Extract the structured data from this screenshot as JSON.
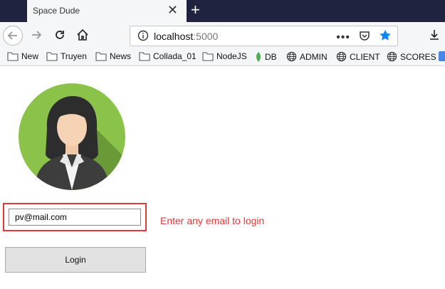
{
  "browser": {
    "tab": {
      "title": "Space Dude",
      "close_icon": "close-icon"
    },
    "url": {
      "host": "localhost",
      "port": ":5000"
    },
    "bookmarks": [
      {
        "label": "New",
        "icon": "folder-icon"
      },
      {
        "label": "Truyen",
        "icon": "folder-icon"
      },
      {
        "label": "News",
        "icon": "folder-icon"
      },
      {
        "label": "Collada_01",
        "icon": "folder-icon"
      },
      {
        "label": "NodeJS",
        "icon": "folder-icon"
      },
      {
        "label": "DB",
        "icon": "leaf-icon"
      },
      {
        "label": "ADMIN",
        "icon": "globe-icon"
      },
      {
        "label": "CLIENT",
        "icon": "globe-icon"
      },
      {
        "label": "SCORES",
        "icon": "globe-icon"
      }
    ]
  },
  "login": {
    "email_value": "pv@mail.com",
    "error_message": "Enter any email to login",
    "button_label": "Login"
  },
  "colors": {
    "error": "#e23a3a",
    "tabbar": "#202340",
    "avatar_green": "#8bc34a"
  }
}
